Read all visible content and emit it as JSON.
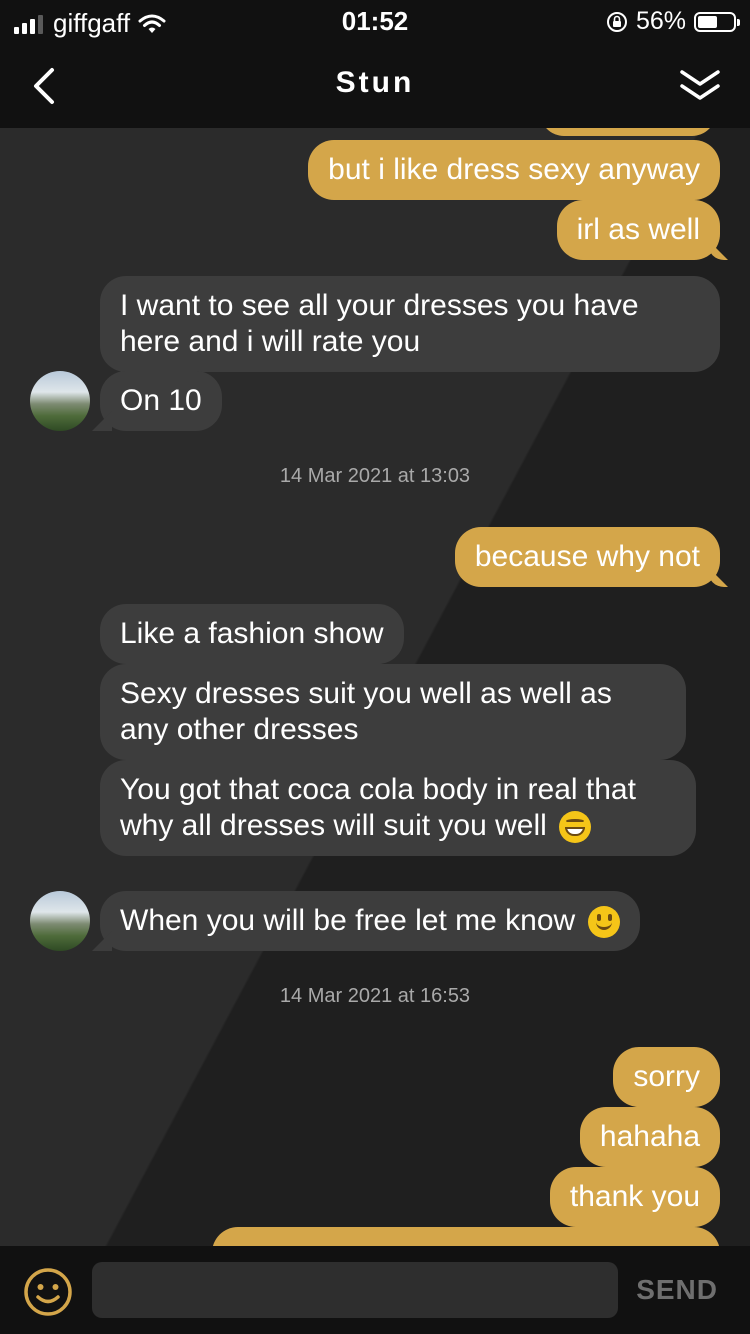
{
  "status_bar": {
    "carrier": "giffgaff",
    "time": "01:52",
    "battery_percent": "56%",
    "battery_level": 0.56,
    "icons": [
      "signal-icon",
      "wifi-icon",
      "orientation-lock-icon",
      "battery-icon"
    ]
  },
  "header": {
    "title": "Stun",
    "back_icon": "chevron-left-icon",
    "collapse_icon": "double-chevron-down-icon"
  },
  "messages": [
    {
      "direction": "out",
      "text": "but i like dress sexy anyway"
    },
    {
      "direction": "out",
      "text": "irl as well"
    },
    {
      "direction": "in",
      "text": "I want to see all your dresses you have here and i will rate you"
    },
    {
      "direction": "in",
      "text": "On 10"
    },
    {
      "type": "timestamp",
      "text": "14 Mar 2021 at 13:03"
    },
    {
      "direction": "out",
      "text": "because why not"
    },
    {
      "direction": "in",
      "text": "Like a fashion show"
    },
    {
      "direction": "in",
      "text": "Sexy dresses suit you well as well as any other dresses"
    },
    {
      "direction": "in",
      "text": "You got that coca cola body in real that why all dresses will suit you well",
      "emoji": "grinning-face-icon"
    },
    {
      "direction": "in",
      "text": "When you will be free let me know",
      "emoji": "slightly-smiling-face-icon"
    },
    {
      "type": "timestamp",
      "text": "14 Mar 2021 at 16:53"
    },
    {
      "direction": "out",
      "text": "sorry"
    },
    {
      "direction": "out",
      "text": "hahaha"
    },
    {
      "direction": "out",
      "text": "thank you"
    }
  ],
  "composer": {
    "emoji_icon": "smiley-icon",
    "input_value": "",
    "input_placeholder": "",
    "send_label": "SEND"
  },
  "colors": {
    "outgoing_bubble": "#d4a64a",
    "incoming_bubble": "#3d3d3d",
    "background": "#262626",
    "bar": "#111111",
    "accent": "#d4a64a"
  }
}
